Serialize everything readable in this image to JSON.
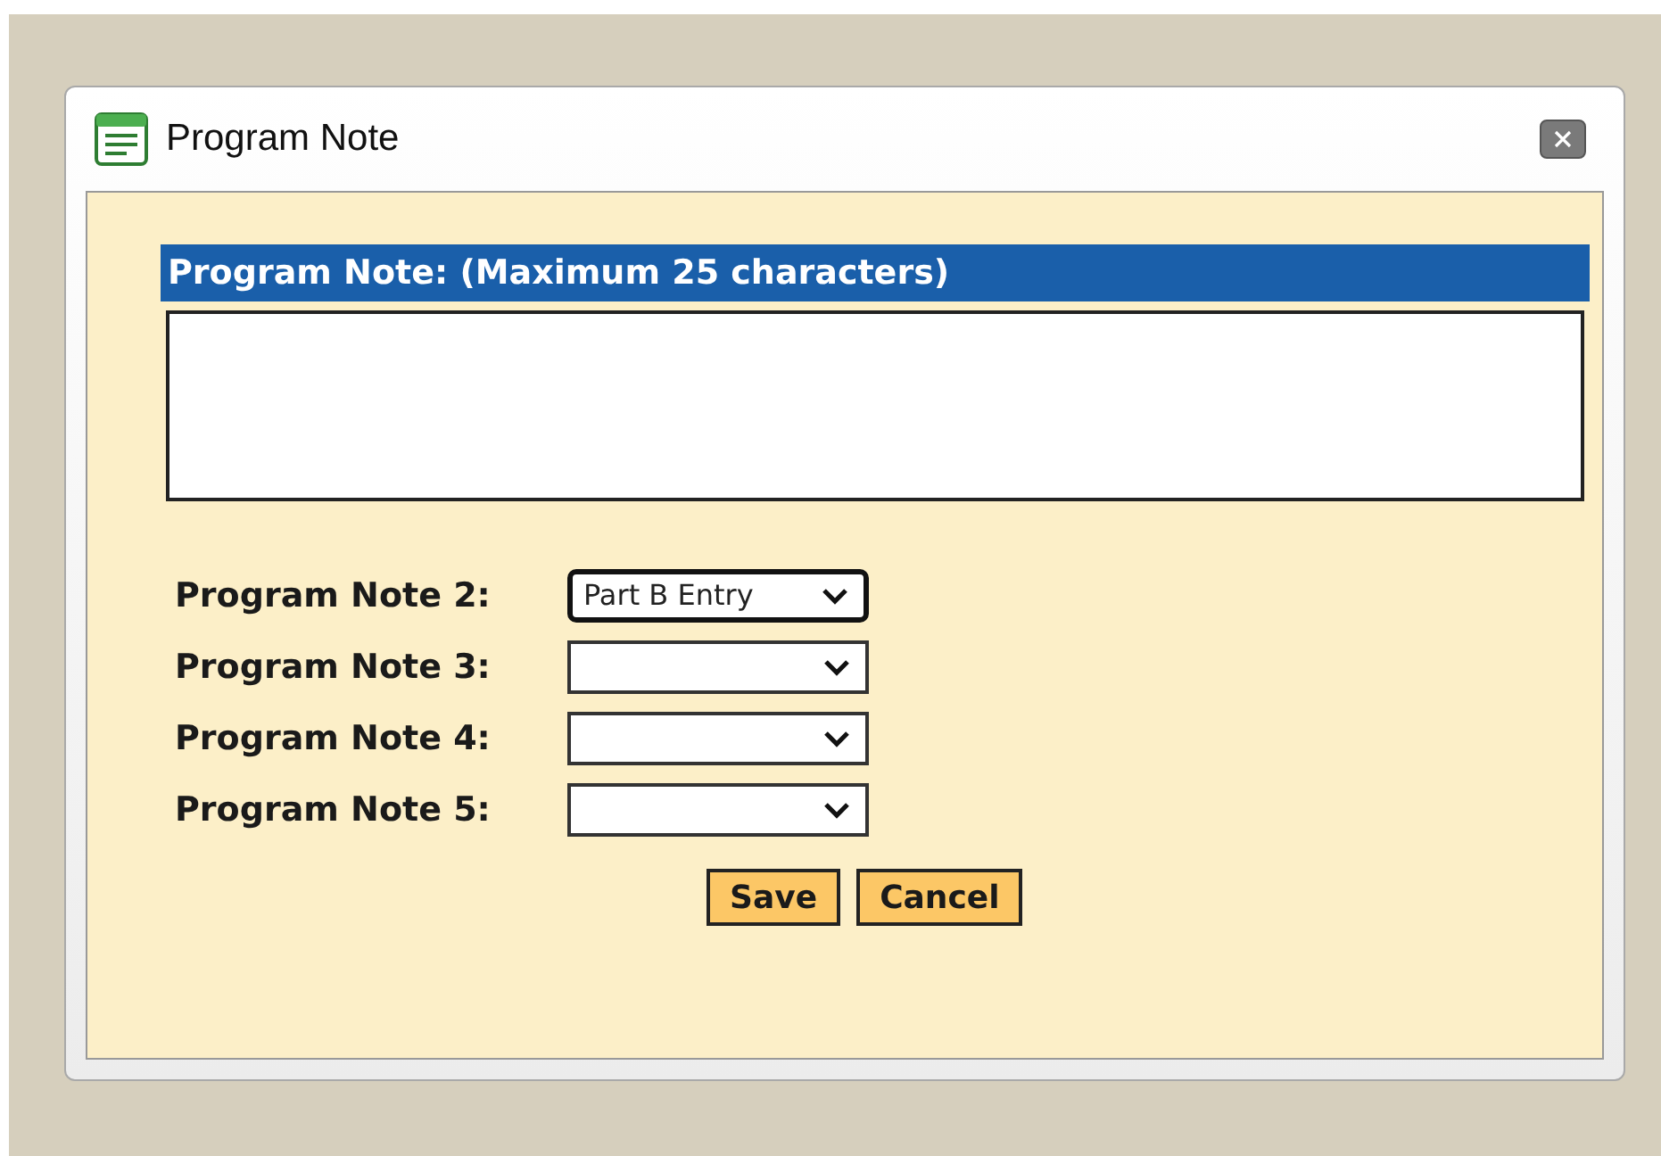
{
  "window": {
    "title": "Program Note"
  },
  "note_field": {
    "label": "Program Note: (Maximum 25 characters)"
  },
  "selects": [
    {
      "label": "Program Note 2:",
      "value": "Part B Entry",
      "focused": true
    },
    {
      "label": "Program Note 3:",
      "focused": false
    },
    {
      "label": "Program Note 4:",
      "focused": false
    },
    {
      "label": "Program Note 5:",
      "focused": false
    }
  ],
  "buttons": [
    "Save",
    "Cancel"
  ]
}
